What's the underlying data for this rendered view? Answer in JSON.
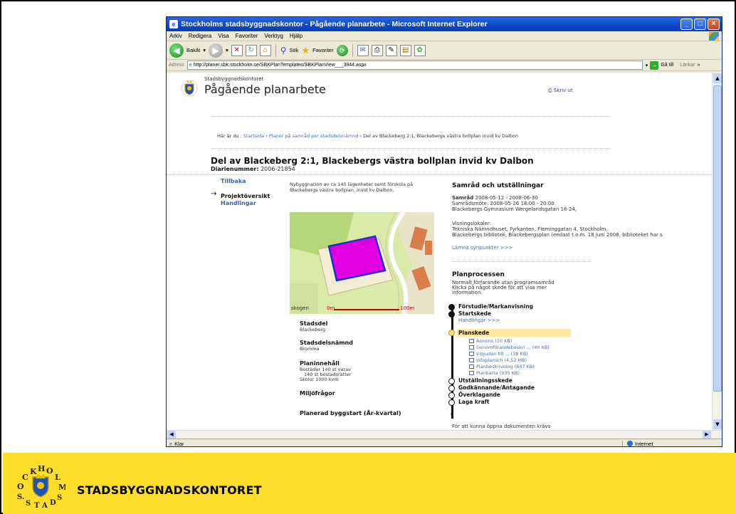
{
  "window": {
    "title": "Stockholms stadsbyggnadskontor - Pågående planarbete - Microsoft Internet Explorer",
    "menu": [
      "Arkiv",
      "Redigera",
      "Visa",
      "Favoriter",
      "Verktyg",
      "Hjälp"
    ],
    "toolbar": {
      "back": "Bakåt",
      "search": "Sök",
      "favorites": "Favoriter"
    },
    "address_label": "Adress",
    "address_value": "http://planer.sbk.stockholm.se/SBKPlanTemplates/SBKPlanView___3844.aspx",
    "go_label": "Gå till",
    "links_label": "Länkar",
    "status_left": "Klar",
    "status_zone": "Internet"
  },
  "page": {
    "org": "Stadsbyggnadskontoret",
    "title": "Pågående planarbete",
    "print": "Skriv ut",
    "crumb_prefix": "Här är du :",
    "crumb_start": "Startsida",
    "crumb_sep1": " › ",
    "crumb_mid": "Planer på samråd per stadsdelsnämnd",
    "crumb_sep2": " › ",
    "crumb_current": "Del av Blackeberg 2:1, Blackebergs västra bollplan invid kv Dalbon",
    "heading": "Del av Blackeberg 2:1, Blackebergs västra bollplan invid kv Dalbon",
    "diarie_label": "Diarienummer:",
    "diarie_value": "2006-21854",
    "nav_back": "Tillbaka",
    "nav_project": "Projektöversikt",
    "nav_docs": "Handlingar",
    "description": "Nybyggnation av ca 140 lägenheter samt förskola på Blackebergs västra bollplan, invid kv Dalbon.",
    "map_scale_start": "0m",
    "map_scale_end": "100m",
    "map_place": "skogen",
    "stadsdel_label": "Stadsdel",
    "stadsdel_value": "Blackeberg",
    "sdn_label": "Stadsdelsnämnd",
    "sdn_value": "Bromma",
    "planinnehall_label": "Planinnehåll",
    "planinnehall_l1": "Bostäder 140 st varav",
    "planinnehall_l2": "140 st bostadsrätter",
    "planinnehall_l3": "Skolor 1000 kvm",
    "miljo_label": "Miljöfrågor",
    "byggstart_label": "Planerad byggstart (År-kvartal)",
    "samrad_heading": "Samråd och utställningar",
    "samrad_label": "Samråd",
    "samrad_dates": "2008-05-12 - 2008-06-30",
    "samradsmote": "Samrådsmöte: 2008-05-26 18:00 - 20:00",
    "samrad_place": "Blackebergs Gymnasium Wergelandsgatan 16-24,",
    "visning_label": "Visningslokaler:",
    "visning_l1": "Tekniska Nämndhuset, Fyrkanten, Fleminggatan 4, Stockholm,",
    "visning_l2": "Blackebergs bibliotek, Blackebergsplan (endast t.o.m. 18 juni 2008, biblioteket har s",
    "lamna": "Lämna synpunkter >>>",
    "process_heading": "Planprocessen",
    "process_l1": "Normalt förfarande utan programsamråd",
    "process_l2": "Klicka på något skede för att visa mer",
    "process_l3": "information.",
    "stage_forstudie": "Förstudie/Markanvisning",
    "stage_start": "Startskede",
    "stage_start_link": "Handlingar >>>",
    "stage_plan": "Planskede",
    "docs": [
      "Annons (10 KB)",
      "Genomförandebeskri ... (40 KB)",
      "Inbjudan till ... (38 KB)",
      "Infoplansch (4,52 MB)",
      "Planbeskrivning (847 KB)",
      "Plankarta (935 KB)"
    ],
    "stage_utst": "Utställningsskede",
    "stage_godk": "Godkännande/Antagande",
    "stage_overkl": "Överklagande",
    "stage_laga": "Laga kraft",
    "bottom_cut": "För att kunna öppna dokumenten krävs"
  },
  "footer": {
    "title": "STADSBYGGNADSKONTORET"
  },
  "colors": {
    "footer_bg": "#fddf2b",
    "plan_area": "#e000e0",
    "titlebar": "#0b47c6"
  }
}
